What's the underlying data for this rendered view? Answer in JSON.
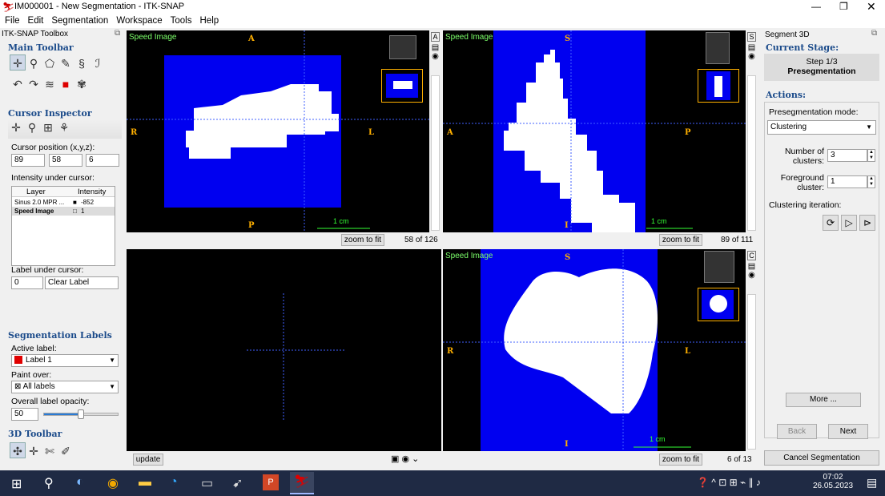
{
  "window": {
    "title": "IM000001 - New Segmentation - ITK-SNAP"
  },
  "menu": [
    "File",
    "Edit",
    "Segmentation",
    "Workspace",
    "Tools",
    "Help"
  ],
  "toolbox": {
    "title": "ITK-SNAP Toolbox",
    "main_toolbar": "Main Toolbar",
    "cursor_inspector": "Cursor Inspector",
    "cursor_position_label": "Cursor position (x,y,z):",
    "cursor_x": "89",
    "cursor_y": "58",
    "cursor_z": "6",
    "intensity_label": "Intensity under cursor:",
    "table_headers": [
      "Layer",
      "Intensity"
    ],
    "rows": [
      {
        "layer": "Sinus 2.0 MPR ...",
        "intensity": "-852"
      },
      {
        "layer": "Speed Image",
        "intensity": "1"
      }
    ],
    "label_under_cursor": "Label under cursor:",
    "label_value": "0",
    "label_name": "Clear Label",
    "seg_labels_title": "Segmentation Labels",
    "active_label_label": "Active label:",
    "active_label": "Label 1",
    "paint_over_label": "Paint over:",
    "paint_over": "All labels",
    "opacity_label": "Overall label opacity:",
    "opacity_value": "50",
    "toolbar_3d": "3D Toolbar"
  },
  "views": {
    "tl": {
      "name": "Speed Image",
      "top": "A",
      "left": "R",
      "right": "L",
      "bottom": "P",
      "scale": "1 cm",
      "zoom": "zoom to fit",
      "slice": "58 of 126"
    },
    "tr": {
      "name": "Speed Image",
      "top": "S",
      "left": "A",
      "right": "P",
      "bottom": "I",
      "scale": "1 cm",
      "zoom": "zoom to fit",
      "slice": "89 of 111"
    },
    "br": {
      "name": "Speed Image",
      "top": "S",
      "left": "R",
      "right": "L",
      "bottom": "I",
      "scale": "1 cm",
      "zoom": "zoom to fit",
      "slice": "6 of 13"
    },
    "bl": {
      "update": "update"
    }
  },
  "segment3d": {
    "title": "Segment 3D",
    "current_stage": "Current Stage:",
    "step": "Step 1/3",
    "stage_name": "Presegmentation",
    "actions": "Actions:",
    "mode_label": "Presegmentation mode:",
    "mode": "Clustering",
    "num_clusters_label": "Number of clusters:",
    "num_clusters": "3",
    "foreground_label": "Foreground cluster:",
    "foreground": "1",
    "iteration_label": "Clustering iteration:",
    "more": "More ...",
    "back": "Back",
    "next": "Next",
    "cancel": "Cancel Segmentation"
  },
  "taskbar": {
    "time": "07:02",
    "date": "26.05.2023"
  },
  "colors": {
    "seg_blue": "#0000f0",
    "accent": "#1a4a8a",
    "label_red": "#e00000",
    "orange": "#ffb000"
  }
}
